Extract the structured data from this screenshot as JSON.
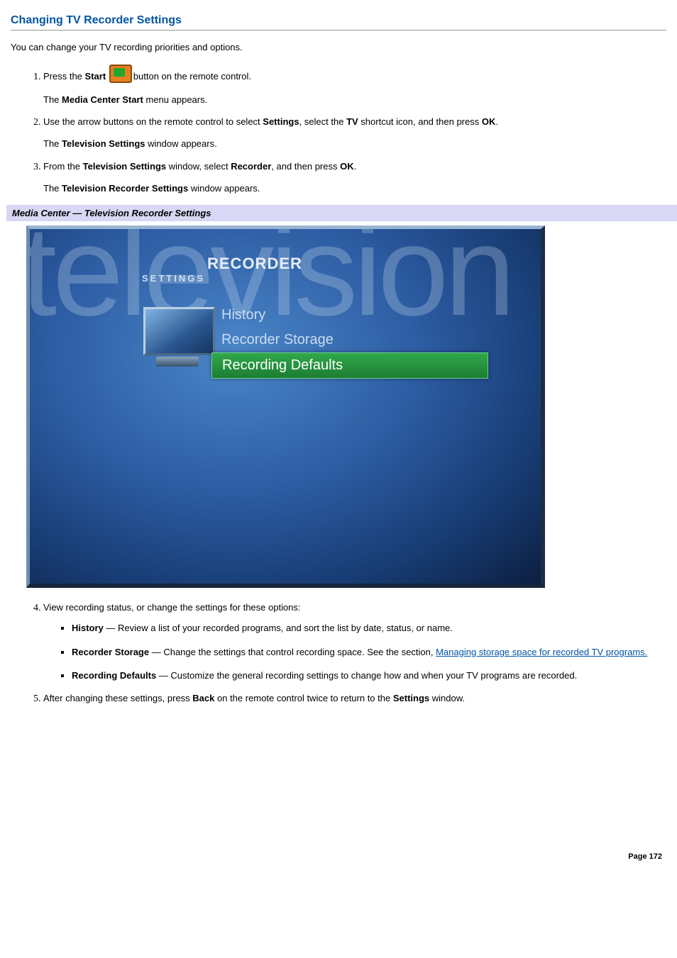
{
  "heading": "Changing TV Recorder Settings",
  "intro": "You can change your TV recording priorities and options.",
  "steps": {
    "s1_a": "Press the ",
    "s1_bold": "Start",
    "s1_b": "button on the remote control.",
    "s1_follow_a": "The ",
    "s1_follow_bold": "Media Center Start",
    "s1_follow_b": " menu appears.",
    "s2_a": "Use the arrow buttons on the remote control to select ",
    "s2_b1": "Settings",
    "s2_c": ", select the ",
    "s2_b2": "TV",
    "s2_d": " shortcut icon, and then press ",
    "s2_b3": "OK",
    "s2_e": ".",
    "s2_follow_a": "The ",
    "s2_follow_bold": "Television Settings",
    "s2_follow_b": " window appears.",
    "s3_a": "From the ",
    "s3_b1": "Television Settings",
    "s3_b": " window, select ",
    "s3_b2": "Recorder",
    "s3_c": ", and then press ",
    "s3_b3": "OK",
    "s3_d": ".",
    "s3_follow_a": "The ",
    "s3_follow_bold": "Television Recorder Settings",
    "s3_follow_b": " window appears.",
    "s4": "View recording status, or change the settings for these options:",
    "s5_a": "After changing these settings, press ",
    "s5_b1": "Back",
    "s5_b": " on the remote control twice to return to the ",
    "s5_b2": "Settings",
    "s5_c": " window."
  },
  "caption": "Media Center — Television Recorder Settings",
  "screenshot": {
    "bgword": "television",
    "title": "RECORDER",
    "subtitle": "SETTINGS",
    "items": [
      "History",
      "Recorder Storage",
      "Recording Defaults"
    ],
    "selected_index": 2
  },
  "bullets": {
    "b1_name": "History",
    "b1_sep": " — ",
    "b1_text": "Review a list of your recorded programs, and sort the list by date, status, or name.",
    "b2_name": "Recorder Storage",
    "b2_sep": " — ",
    "b2_text": "Change the settings that control recording space. See the section, ",
    "b2_link": "Managing storage space for recorded TV programs.",
    "b3_name": "Recording Defaults",
    "b3_sep": " — ",
    "b3_text": "Customize the general recording settings to change how and when your TV programs are recorded."
  },
  "page": "Page 172"
}
